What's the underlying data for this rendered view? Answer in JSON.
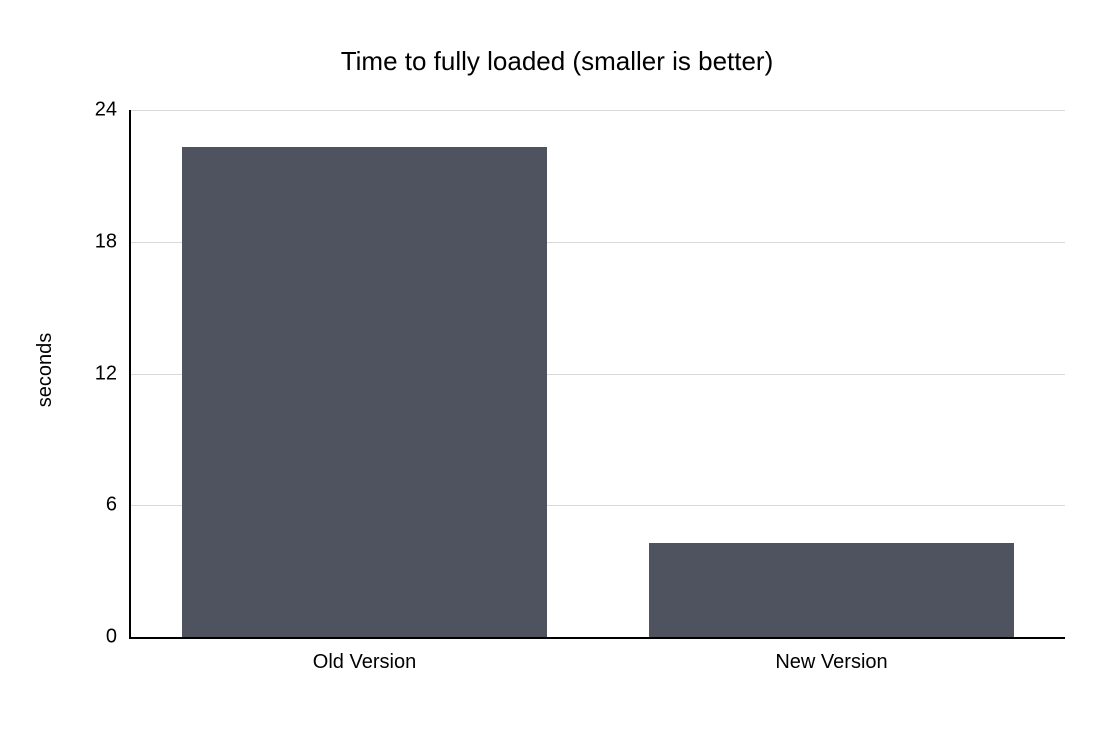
{
  "chart_data": {
    "type": "bar",
    "title": "Time to fully loaded (smaller is better)",
    "ylabel": "seconds",
    "xlabel": "",
    "categories": [
      "Old Version",
      "New Version"
    ],
    "values": [
      22.3,
      4.3
    ],
    "yticks": [
      0,
      6,
      12,
      18,
      24
    ],
    "ylim": [
      0,
      24
    ],
    "grid": true,
    "bar_color": "#4e535f",
    "grid_color": "#d9d9d9"
  }
}
